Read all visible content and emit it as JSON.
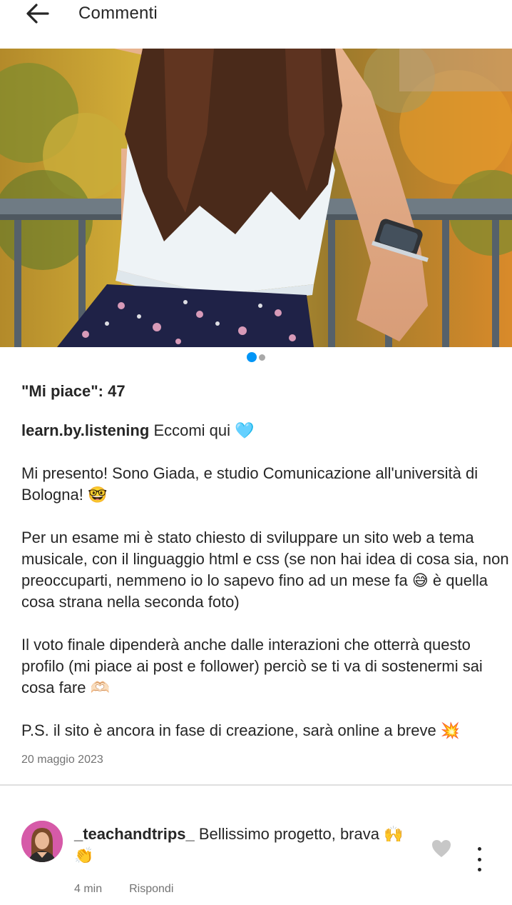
{
  "header": {
    "title": "Commenti"
  },
  "carousel": {
    "count": 2,
    "active_index": 0
  },
  "post": {
    "likes": "\"Mi piace\": 47",
    "username": "learn.by.listening",
    "caption_first": "Eccomi qui 🩵",
    "paragraphs": [
      "Mi presento! Sono Giada, e studio Comunicazione all'università di Bologna! 🤓",
      "Per un esame mi è stato chiesto di sviluppare un sito web a tema musicale, con il linguaggio html e css (se non hai idea di cosa sia, non preoccuparti, nemmeno io lo sapevo fino ad un mese fa 😅 è quella cosa strana nella seconda foto)",
      "Il voto finale dipenderà anche dalle interazioni che otterrà questo profilo (mi piace ai post e follower) perciò se ti va di sostenermi sai cosa fare 🫶🏻",
      "P.S. il sito è ancora in fase di creazione, sarà online a breve 💥"
    ],
    "date": "20 maggio 2023"
  },
  "comment": {
    "username": "_teachandtrips_",
    "text": "Bellissimo progetto, brava 🙌👏",
    "time": "4 min",
    "reply_label": "Rispondi"
  },
  "colors": {
    "accent": "#0095f6",
    "text": "#262626",
    "muted": "#737373"
  },
  "icons": {
    "back": "arrow-left-icon",
    "like": "heart-icon",
    "more": "more-vertical-icon"
  }
}
